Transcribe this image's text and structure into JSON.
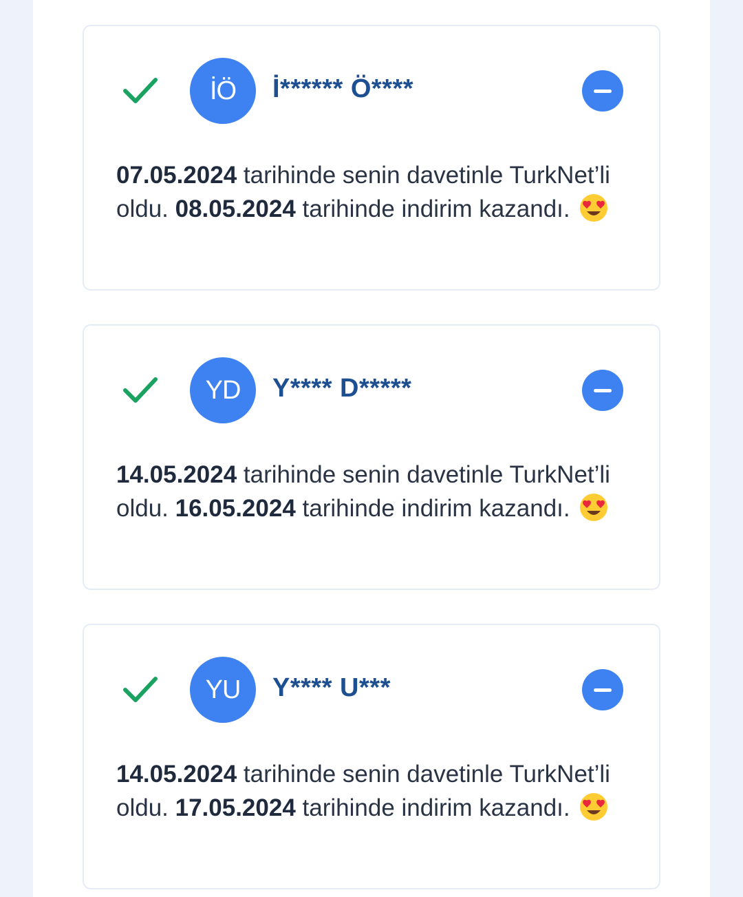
{
  "colors": {
    "accent": "#3d82f0",
    "name_text": "#1d4f91",
    "check": "#1aa260",
    "page_bg": "#eef2fa"
  },
  "referrals": [
    {
      "initials": "İÖ",
      "name": "İ****** Ö****",
      "joined_date": "07.05.2024",
      "joined_text": " tarihinde senin davetinle TurkNet’li oldu. ",
      "discount_date": "08.05.2024",
      "discount_text": " tarihinde indirim kazandı.",
      "status_icon": "check-icon",
      "emoji_icon": "heart-eyes-emoji-icon"
    },
    {
      "initials": "YD",
      "name": "Y**** D*****",
      "joined_date": "14.05.2024",
      "joined_text": " tarihinde senin davetinle TurkNet’li oldu. ",
      "discount_date": "16.05.2024",
      "discount_text": " tarihinde indirim kazandı.",
      "status_icon": "check-icon",
      "emoji_icon": "heart-eyes-emoji-icon"
    },
    {
      "initials": "YU",
      "name": "Y**** U***",
      "joined_date": "14.05.2024",
      "joined_text": " tarihinde senin davetinle TurkNet’li oldu. ",
      "discount_date": "17.05.2024",
      "discount_text": " tarihinde indirim kazandı.",
      "status_icon": "check-icon",
      "emoji_icon": "heart-eyes-emoji-icon"
    }
  ]
}
